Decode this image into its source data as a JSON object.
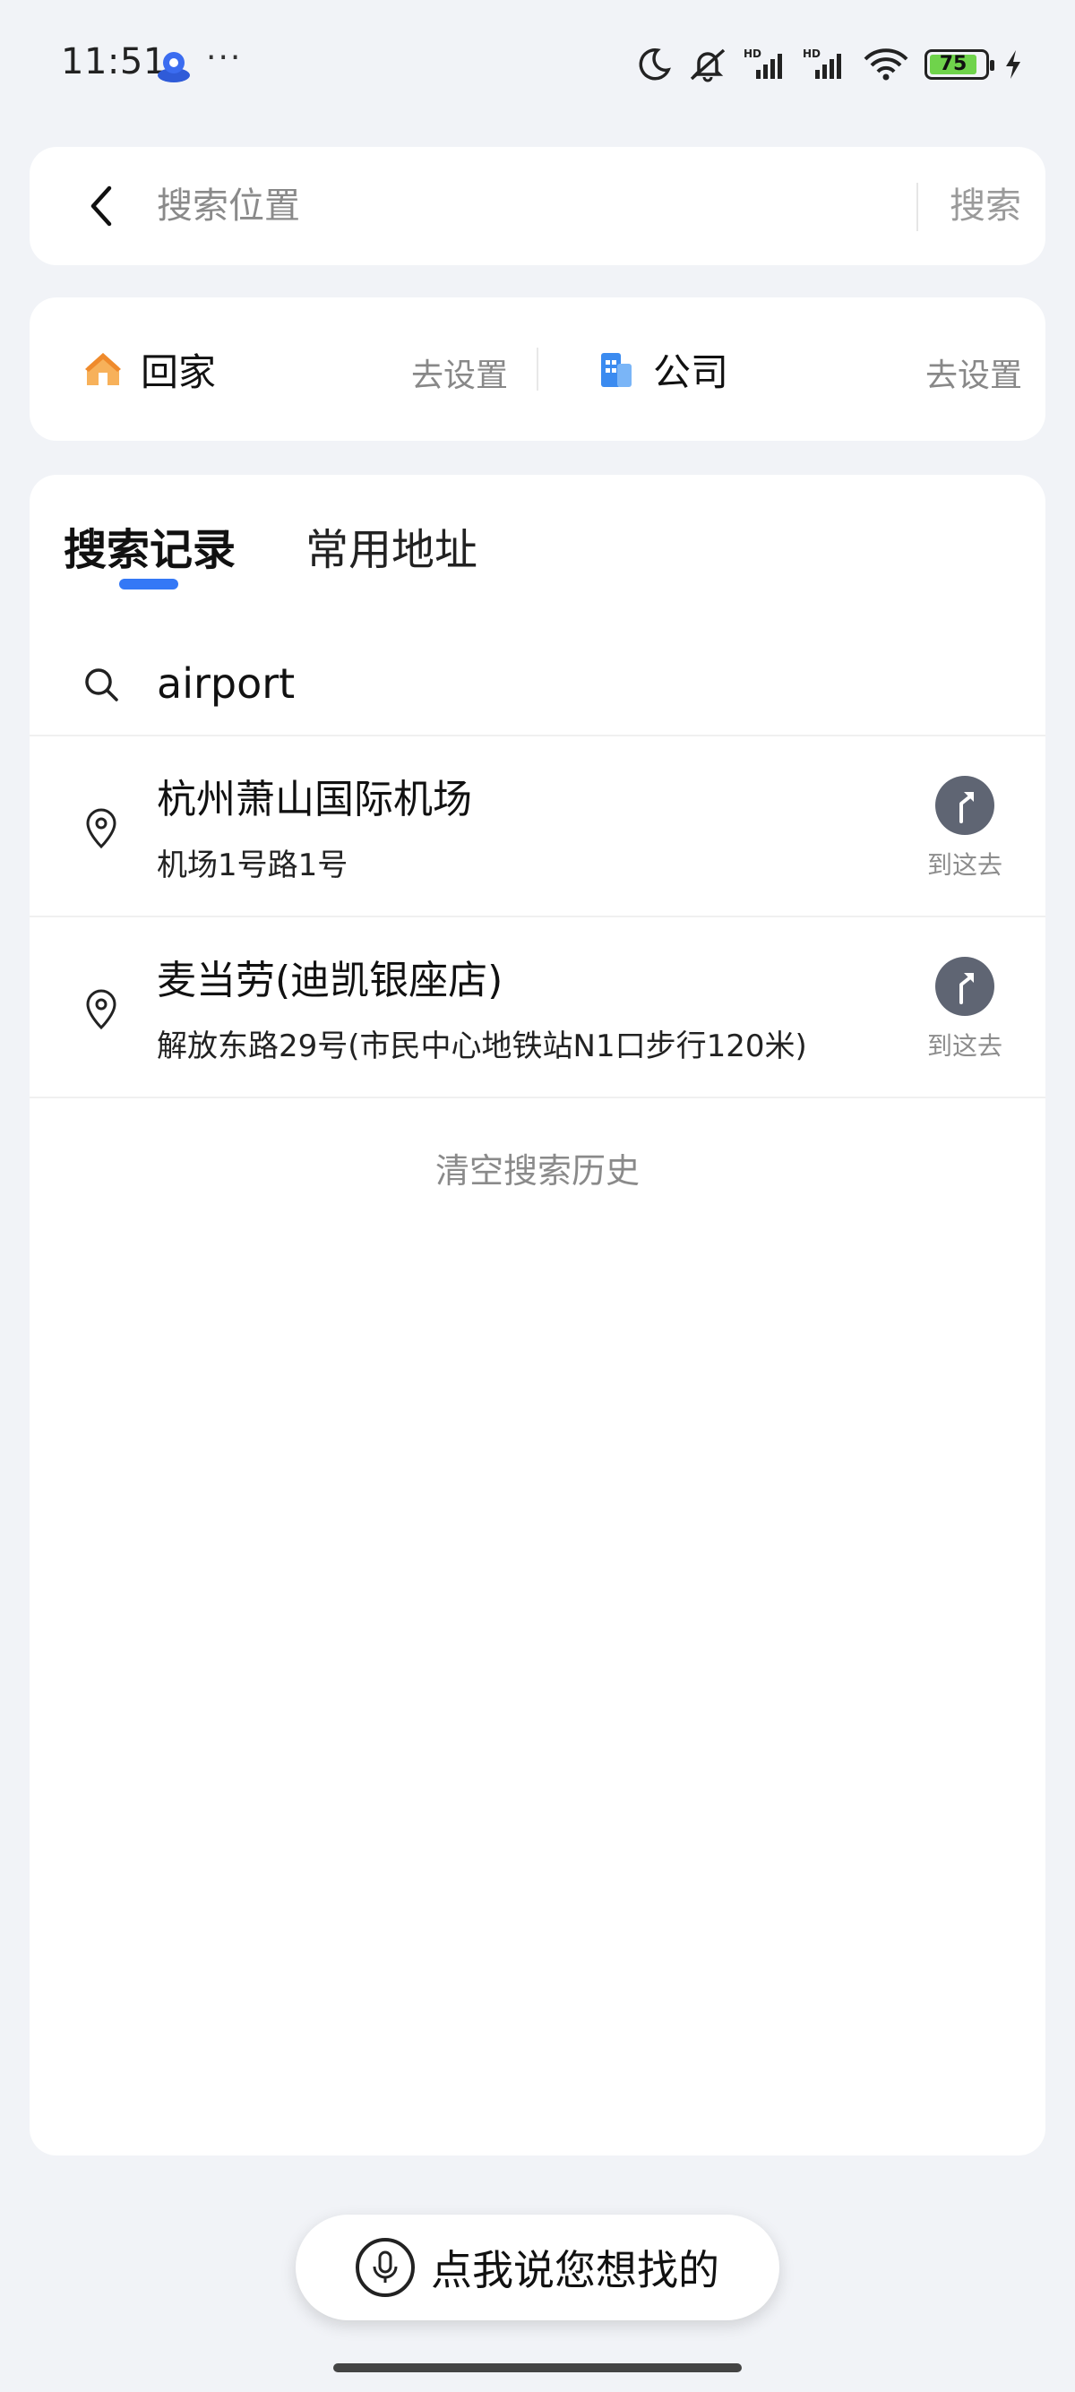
{
  "status_bar": {
    "time": "11:51",
    "dots": "···",
    "battery": "75",
    "colors": {
      "battery_fill": "#6fd34b"
    }
  },
  "search": {
    "placeholder": "搜索位置",
    "value": "",
    "button": "搜索"
  },
  "quick": {
    "home_label": "回家",
    "home_action": "去设置",
    "work_label": "公司",
    "work_action": "去设置"
  },
  "tabs": [
    {
      "label": "搜索记录",
      "active": true
    },
    {
      "label": "常用地址",
      "active": false
    }
  ],
  "history": {
    "query": "airport",
    "places": [
      {
        "name": "杭州萧山国际机场",
        "address": "机场1号路1号",
        "action": "到这去"
      },
      {
        "name": "麦当劳(迪凯银座店)",
        "address": "解放东路29号(市民中心地铁站N1口步行120米)",
        "action": "到这去"
      }
    ],
    "clear": "清空搜索历史"
  },
  "voice": {
    "label": "点我说您想找的"
  },
  "colors": {
    "accent": "#3478f6",
    "background": "#f1f3f7",
    "goto_circle": "#5f6573"
  }
}
